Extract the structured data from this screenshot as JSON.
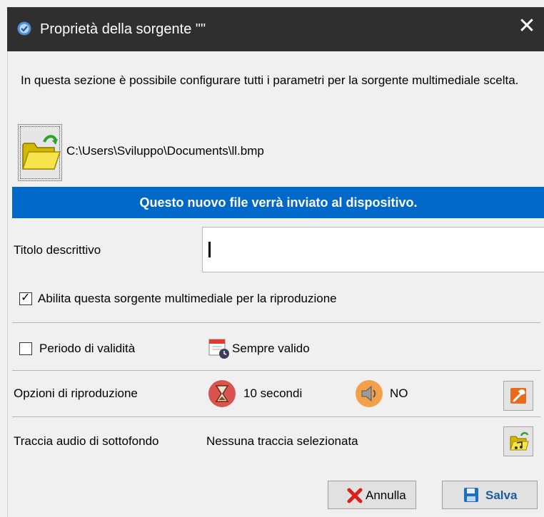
{
  "window": {
    "title": "Proprietà della sorgente \"\"",
    "close_glyph": "✕"
  },
  "intro_text": "In questa sezione è possibile configurare tutti i parametri per la sorgente multimediale scelta.",
  "file": {
    "path": "C:\\Users\\Sviluppo\\Documents\\ll.bmp",
    "icon": "folder-open-icon"
  },
  "banner": {
    "text": "Questo nuovo file verrà inviato al dispositivo.",
    "color": "#0068c8"
  },
  "title_field": {
    "label": "Titolo descrittivo",
    "value": ""
  },
  "enable_playback": {
    "label": "Abilita questa sorgente multimediale per la riproduzione",
    "checked": true
  },
  "validity": {
    "label": "Periodo di validità",
    "checked": false,
    "status": "Sempre valido",
    "icon": "calendar-clock-icon"
  },
  "playback_options": {
    "label": "Opzioni di riproduzione",
    "duration": "10 secondi",
    "audio": "NO",
    "duration_icon": "hourglass-icon",
    "audio_icon": "speaker-icon",
    "settings_icon": "wrench-icon"
  },
  "background_audio": {
    "label": "Traccia audio di sottofondo",
    "value": "Nessuna traccia selezionata",
    "icon": "music-folder-icon"
  },
  "buttons": {
    "cancel": "Annulla",
    "save": "Salva"
  }
}
